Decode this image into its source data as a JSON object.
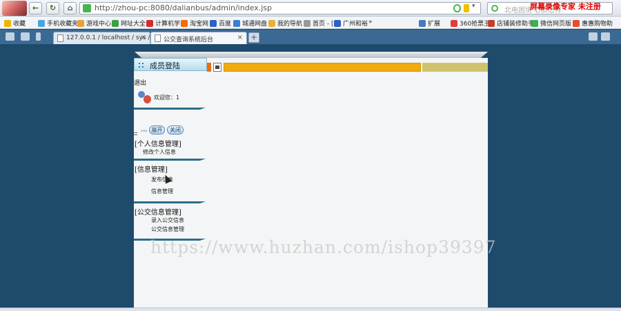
{
  "browser": {
    "url": "http://zhou-pc:8080/dalianbus/admin/index.jsp",
    "search_placeholder": "北电困境 心肠怎样",
    "overlay_text": "屏幕录像专家 未注册"
  },
  "bookmarks": [
    {
      "label": "收藏",
      "icon_color": "#f0b400"
    },
    {
      "label": "手机收藏夹",
      "icon_color": "#4aa3df"
    },
    {
      "label": "游戏中心",
      "icon_color": "#e9a23b"
    },
    {
      "label": "网址大全",
      "icon_color": "#3aa141"
    },
    {
      "label": "计算机学",
      "icon_color": "#d32c2c"
    },
    {
      "label": "淘宝网",
      "icon_color": "#f56a00"
    },
    {
      "label": "百度",
      "icon_color": "#2d5fc6"
    },
    {
      "label": "城通网盘",
      "icon_color": "#3b7fd0"
    },
    {
      "label": "我的导航",
      "icon_color": "#e7b13a"
    },
    {
      "label": "首页 - [",
      "icon_color": "#999999"
    },
    {
      "label": "广州和裕",
      "icon_color": "#2d5fc6"
    },
    {
      "label": "»",
      "icon_color": ""
    },
    {
      "label": "扩展",
      "icon_color": "#4a78c2"
    },
    {
      "label": "360抢票王",
      "icon_color": "#e23c3c"
    },
    {
      "label": "店铺装修助手",
      "icon_color": "#c83c2a"
    },
    {
      "label": "微信网页版",
      "icon_color": "#3bb24a"
    },
    {
      "label": "惠惠购物助",
      "icon_color": "#e54d2e"
    }
  ],
  "tabs": [
    {
      "label": "127.0.0.1 / localhost / sys /",
      "close": "×"
    },
    {
      "label": "公交查询系统后台",
      "close": "×"
    }
  ],
  "new_tab": "+",
  "sidebar": {
    "header": "成员登陆",
    "logout": "退出",
    "welcome": "欢迎您：1",
    "arrows": "›››",
    "expand_button": "展开",
    "close_button": "关闭",
    "groups": [
      {
        "title": "[个人信息管理]",
        "items": [
          "修改个人信息"
        ]
      },
      {
        "title": "[信息管理]",
        "items": [
          "发布信息",
          "信息管理"
        ]
      },
      {
        "title": "[公交信息管理]",
        "items": [
          "录入公交信息",
          "公交信息管理"
        ]
      }
    ]
  },
  "watermark": "https://www.huzhan.com/ishop39397",
  "colors": {
    "background": "#1e4b6c",
    "content_bar_orange": "#efab0f",
    "content_bar_olive": "#cfc36d",
    "divider": "#2b6e88"
  }
}
